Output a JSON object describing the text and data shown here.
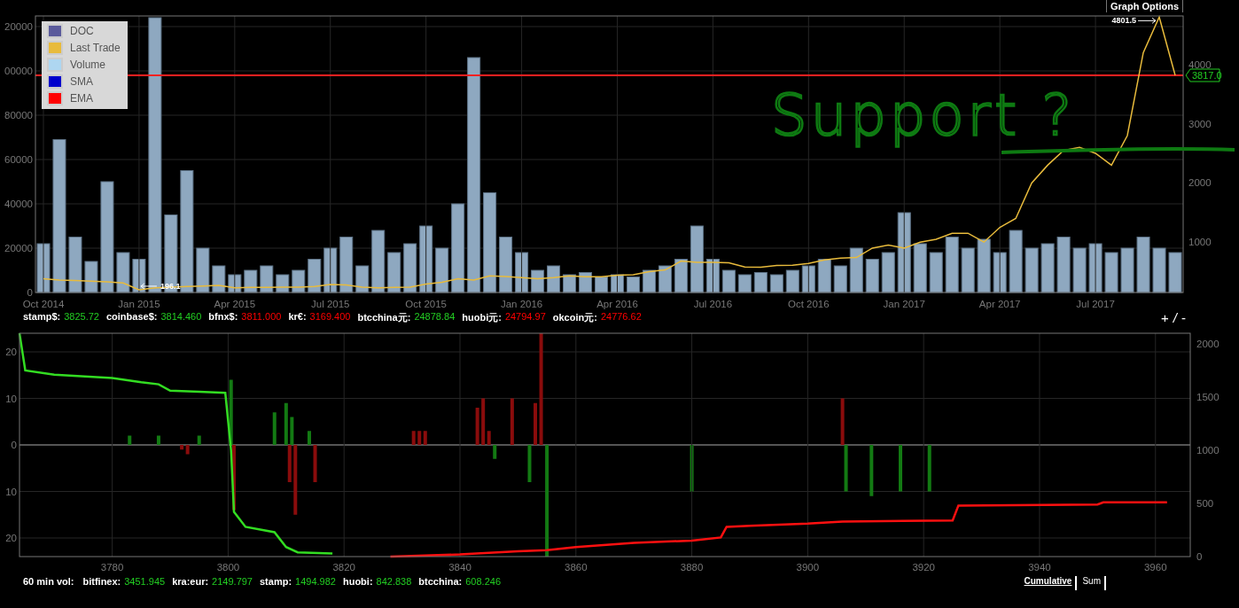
{
  "graph_options": {
    "label": "Graph Options"
  },
  "legend": [
    {
      "label": "DOC",
      "color": "#5b5b9c"
    },
    {
      "label": "Last Trade",
      "color": "#e8bb3c"
    },
    {
      "label": "Volume",
      "color": "#aed6f1"
    },
    {
      "label": "SMA",
      "color": "#0000cc"
    },
    {
      "label": "EMA",
      "color": "#ff0000"
    }
  ],
  "price_panel": {
    "volume": {
      "chart_data": {
        "type": "bar",
        "grid": true,
        "categories": [
          null,
          null,
          null,
          null,
          null,
          null,
          null,
          null,
          null,
          null,
          null,
          null,
          null,
          null,
          null,
          null,
          null,
          null,
          null,
          null,
          null,
          null,
          null,
          null,
          null,
          null,
          null,
          null,
          null,
          null,
          null,
          null,
          null,
          null,
          null,
          null,
          null,
          null,
          null,
          null,
          null,
          null,
          null,
          null,
          null,
          null,
          null,
          null,
          null,
          null,
          null,
          null,
          null,
          null,
          null,
          null,
          null,
          null,
          null,
          null,
          null,
          null,
          null,
          null,
          null,
          null,
          null,
          null,
          null,
          null,
          null,
          null
        ],
        "series": [
          {
            "color": "#8ea8c0",
            "values": [
              22000,
              69000,
              25000,
              14000,
              50000,
              18000,
              15000,
              124000,
              35000,
              55000,
              20000,
              12000,
              8000,
              10000,
              12000,
              8000,
              10000,
              15000,
              20000,
              25000,
              12000,
              28000,
              18000,
              22000,
              30000,
              20000,
              40000,
              106000,
              45000,
              25000,
              18000,
              10000,
              12000,
              8000,
              9000,
              7000,
              8000,
              7000,
              10000,
              12000,
              15000,
              30000,
              15000,
              10000,
              8000,
              9000,
              8000,
              10000,
              12000,
              15000,
              12000,
              20000,
              15000,
              18000,
              36000,
              22000,
              18000,
              25000,
              20000,
              24000,
              18000,
              28000,
              20000,
              22000,
              25000,
              20000,
              22000,
              18000,
              20000,
              25000,
              20000,
              18000
            ]
          }
        ],
        "ylim": [
          0,
          124800
        ],
        "yticks": [
          0,
          20000,
          40000,
          60000,
          80000
        ]
      }
    },
    "volume_axis_cut_labels": [
      "20000",
      "00000"
    ],
    "price": {
      "chart_data": {
        "type": "line",
        "grid": true,
        "categories": [
          "Oct 2014",
          null,
          null,
          null,
          null,
          null,
          "Jan 2015",
          null,
          null,
          null,
          null,
          null,
          "Apr 2015",
          null,
          null,
          null,
          null,
          null,
          "Jul 2015",
          null,
          null,
          null,
          null,
          null,
          "Oct 2015",
          null,
          null,
          null,
          null,
          null,
          "Jan 2016",
          null,
          null,
          null,
          null,
          null,
          "Apr 2016",
          null,
          null,
          null,
          null,
          null,
          "Jul 2016",
          null,
          null,
          null,
          null,
          null,
          "Oct 2016",
          null,
          null,
          null,
          null,
          null,
          "Jan 2017",
          null,
          null,
          null,
          null,
          null,
          "Apr 2017",
          null,
          null,
          null,
          null,
          null,
          "Jul 2017",
          null,
          null,
          null,
          null,
          null
        ],
        "series": [
          {
            "color": "#e8bb3c",
            "values": [
              380,
              360,
              350,
              340,
              330,
              310,
              196,
              230,
              240,
              250,
              260,
              270,
              230,
              235,
              235,
              240,
              240,
              250,
              285,
              275,
              240,
              230,
              235,
              240,
              290,
              320,
              380,
              360,
              430,
              420,
              400,
              380,
              400,
              430,
              415,
              415,
              440,
              450,
              500,
              530,
              680,
              660,
              660,
              650,
              580,
              575,
              605,
              610,
              640,
              700,
              730,
              740,
              900,
              950,
              900,
              1000,
              1050,
              1150,
              1150,
              1000,
              1250,
              1400,
              2000,
              2300,
              2550,
              2600,
              2500,
              2300,
              2800,
              4200,
              4800,
              3817
            ]
          }
        ],
        "ylim": [
          150,
          4820
        ],
        "yticks": [
          1000,
          2000,
          3000,
          4000
        ],
        "annotations": [
          "4801.5",
          "196.1"
        ]
      }
    },
    "last_price_label": "3817.0",
    "handwritten_note": "Support ?"
  },
  "tickers": [
    {
      "exchange": "stamp$:",
      "value": "3825.72",
      "color": "#22cc22"
    },
    {
      "exchange": "coinbase$:",
      "value": "3814.460",
      "color": "#22cc22"
    },
    {
      "exchange": "bfnx$:",
      "value": "3811.000",
      "color": "#ff0000"
    },
    {
      "exchange": "kr€:",
      "value": "3169.400",
      "color": "#ff0000"
    },
    {
      "exchange": "btcchina元:",
      "value": "24878.84",
      "color": "#22cc22"
    },
    {
      "exchange": "huobi元:",
      "value": "24794.97",
      "color": "#ff0000"
    },
    {
      "exchange": "okcoin元:",
      "value": "24776.62",
      "color": "#ff0000"
    }
  ],
  "zoom": {
    "plus": "+",
    "separator": "/",
    "minus": "-"
  },
  "depth_panel": {
    "flow": {
      "chart_data": {
        "type": "bar",
        "grid": true,
        "x": [
          3783,
          3788,
          3792,
          3793,
          3795,
          3800.5,
          3801,
          3808,
          3810,
          3810.6,
          3811,
          3811.6,
          3814,
          3815,
          3832,
          3833,
          3834,
          3843,
          3844,
          3845,
          3846,
          3849,
          3852,
          3853,
          3854,
          3855,
          3880,
          3906,
          3906.6,
          3911,
          3916,
          3921
        ],
        "series": [
          {
            "color": "#137a13",
            "values": [
              2,
              2,
              null,
              null,
              2,
              14,
              null,
              7,
              9,
              null,
              6,
              null,
              3,
              null,
              null,
              null,
              null,
              null,
              null,
              null,
              -3,
              null,
              -8,
              null,
              null,
              -24,
              -10,
              null,
              -10,
              -11,
              -10,
              -10
            ]
          },
          {
            "color": "#8a0c0c",
            "values": [
              null,
              null,
              -1,
              -2,
              null,
              null,
              -14,
              null,
              null,
              -8,
              null,
              -15,
              null,
              -8,
              3,
              3,
              3,
              8,
              10,
              3,
              null,
              10,
              null,
              9,
              24,
              null,
              null,
              10,
              null,
              null,
              null,
              null
            ]
          }
        ],
        "xlim": [
          3764,
          3966
        ],
        "ylim": [
          -24,
          24
        ],
        "yticks": [
          {
            "value": 20,
            "label": "20"
          },
          {
            "value": 10,
            "label": "10"
          },
          {
            "value": 0,
            "label": "0"
          },
          {
            "value": -10,
            "label": "10"
          },
          {
            "value": -20,
            "label": "20"
          }
        ]
      }
    },
    "cumulative": {
      "chart_data": {
        "type": "line",
        "grid": true,
        "series": [
          {
            "color": "#33dd22",
            "x": [
              3764,
              3765,
              3770,
              3780,
              3785,
              3788,
              3790,
              3795,
              3799.5,
              3800.5,
              3801,
              3803,
              3808,
              3810,
              3812,
              3818
            ],
            "values": [
              2100,
              1750,
              1710,
              1680,
              1640,
              1620,
              1560,
              1550,
              1540,
              1000,
              420,
              280,
              230,
              90,
              40,
              30
            ]
          },
          {
            "color": "#ff1010",
            "x": [
              3828,
              3840,
              3850,
              3855,
              3860,
              3870,
              3880,
              3885,
              3886,
              3890,
              3900,
              3906,
              3925,
              3926,
              3950,
              3951,
              3962
            ],
            "values": [
              0,
              20,
              50,
              60,
              90,
              130,
              150,
              180,
              280,
              290,
              310,
              330,
              340,
              480,
              490,
              510,
              510
            ]
          }
        ],
        "xlim": [
          3764,
          3966
        ],
        "ylim": [
          0,
          2100
        ],
        "xticks": [
          3780,
          3800,
          3820,
          3840,
          3860,
          3880,
          3900,
          3920,
          3940,
          3960
        ],
        "yticks": [
          0,
          500,
          1000,
          1500,
          2000
        ]
      }
    }
  },
  "volume_row": {
    "label": "60 min vol:",
    "items": [
      {
        "exchange": "bitfinex:",
        "value": "3451.945"
      },
      {
        "exchange": "kra:eur:",
        "value": "2149.797"
      },
      {
        "exchange": "stamp:",
        "value": "1494.982"
      },
      {
        "exchange": "huobi:",
        "value": "842.838"
      },
      {
        "exchange": "btcchina:",
        "value": "608.246"
      }
    ]
  },
  "view_toggle": [
    {
      "label": "Cumulative",
      "selected": true
    },
    {
      "label": "Sum",
      "selected": false
    }
  ]
}
